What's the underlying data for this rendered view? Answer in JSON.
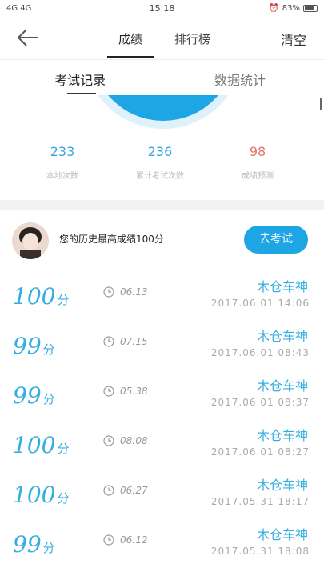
{
  "status_bar": {
    "network": "4G 4G",
    "time": "15:18",
    "battery": "83%"
  },
  "header": {
    "tabs": [
      "成绩",
      "排行榜"
    ],
    "clear_label": "清空"
  },
  "sub_tabs": [
    "考试记录",
    "数据统计"
  ],
  "stats": [
    {
      "value": "233",
      "label": "本地次数",
      "color": "#3aa6dd"
    },
    {
      "value": "236",
      "label": "累计考试次数",
      "color": "#3aa6dd"
    },
    {
      "value": "98",
      "label": "成绩预测",
      "color": "#e4756c"
    }
  ],
  "best": {
    "text": "您的历史最高成绩100分",
    "button_label": "去考试"
  },
  "records": [
    {
      "score": "100",
      "unit": "分",
      "duration": "06:13",
      "name": "木仓车神",
      "date": "2017.06.01  14:06"
    },
    {
      "score": "99",
      "unit": "分",
      "duration": "07:15",
      "name": "木仓车神",
      "date": "2017.06.01  08:43"
    },
    {
      "score": "99",
      "unit": "分",
      "duration": "05:38",
      "name": "木仓车神",
      "date": "2017.06.01  08:37"
    },
    {
      "score": "100",
      "unit": "分",
      "duration": "08:08",
      "name": "木仓车神",
      "date": "2017.06.01  08:27"
    },
    {
      "score": "100",
      "unit": "分",
      "duration": "06:27",
      "name": "木仓车神",
      "date": "2017.05.31  18:17"
    },
    {
      "score": "99",
      "unit": "分",
      "duration": "06:12",
      "name": "木仓车神",
      "date": "2017.05.31  18:08"
    }
  ],
  "colors": {
    "accent": "#1ea6e4",
    "score": "#34aee0",
    "prediction": "#e4756c"
  }
}
